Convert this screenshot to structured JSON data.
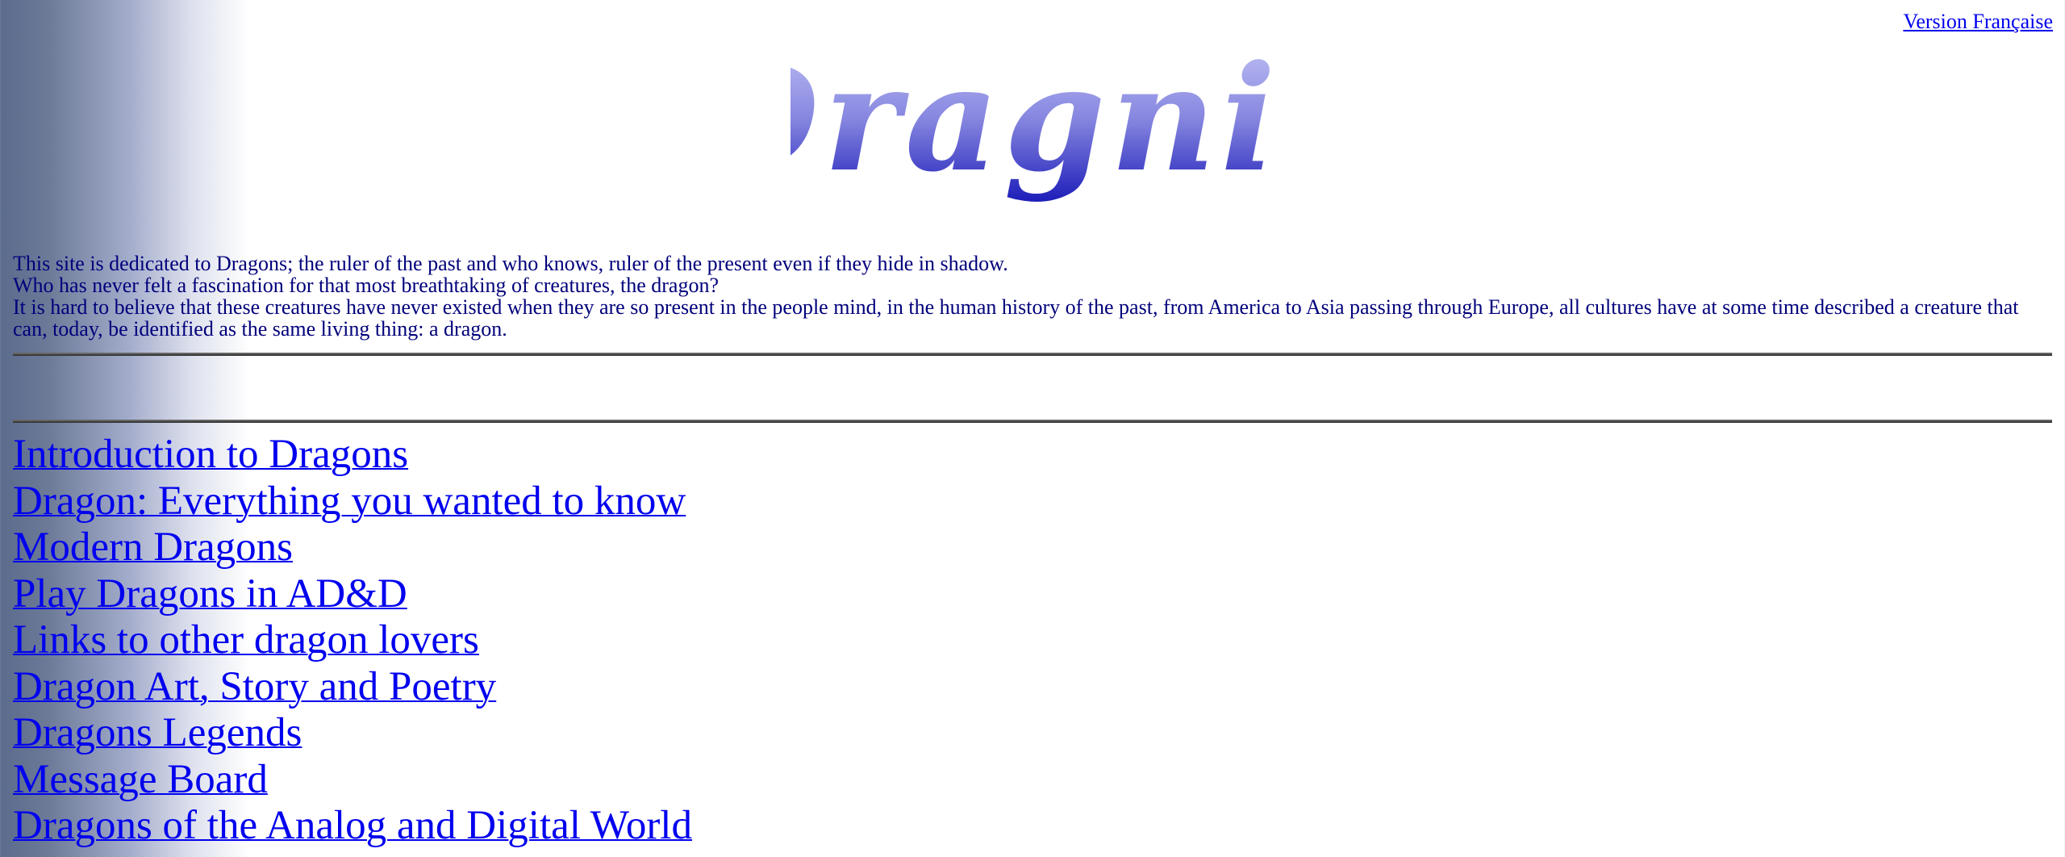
{
  "header": {
    "language_link": "Version Française",
    "logo_text": "Dragnix"
  },
  "intro": {
    "lines": [
      "This site is dedicated to Dragons; the ruler of the past and who knows, ruler of the present even if they hide in shadow.",
      "Who has never felt a fascination for that most breathtaking of creatures, the dragon?",
      "It is hard to believe that these creatures have never existed when they are so present in the people mind, in the human history of the past, from America to Asia passing through Europe, all cultures have at some time described a creature that can, today, be identified as the same living thing: a dragon."
    ]
  },
  "nav": {
    "links": [
      "Introduction to Dragons",
      "Dragon: Everything you wanted to know",
      "Modern Dragons",
      "Play Dragons in AD&D",
      "Links to other dragon lovers",
      "Dragon Art, Story and Poetry",
      "Dragons Legends",
      "Message Board",
      "Dragons of the Analog and Digital World"
    ]
  },
  "colors": {
    "link": "#0000ee",
    "body_text": "#00007b",
    "logo_light": "#b8b8f4",
    "logo_dark": "#2020c0",
    "rule": "#666666"
  }
}
